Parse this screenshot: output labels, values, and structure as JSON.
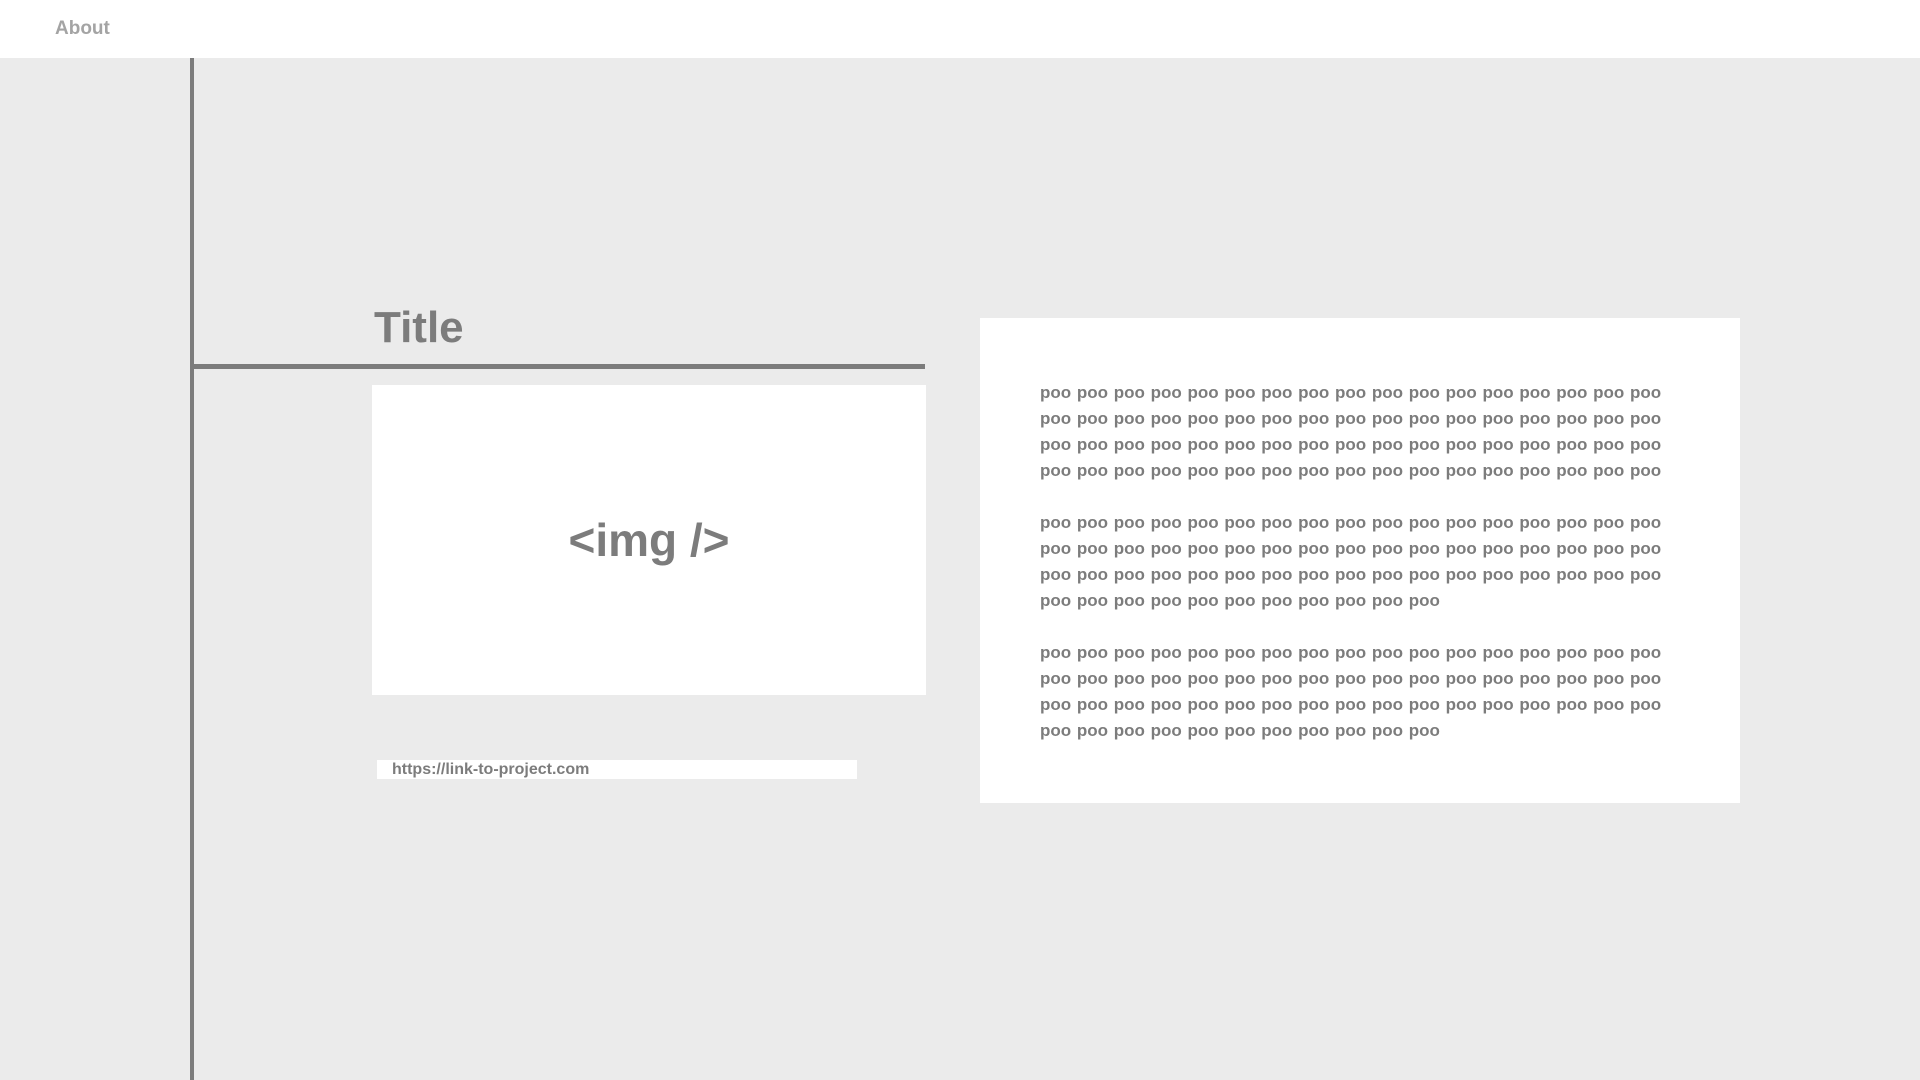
{
  "nav": {
    "about_label": "About"
  },
  "project": {
    "title": "Title",
    "image_placeholder": "<img />",
    "link": "https://link-to-project.com"
  },
  "description": {
    "paragraphs": [
      "poo poo poo poo poo poo poo poo poo poo poo poo poo poo poo poo poo poo poo poo poo poo poo poo poo poo poo poo poo poo poo poo poo poo poo poo poo poo poo poo poo poo poo poo poo poo poo poo poo poo poo poo poo poo poo poo poo poo poo poo poo poo poo poo poo poo poo poo",
      "poo poo poo poo poo poo poo poo poo poo poo poo poo poo poo poo poo poo poo poo poo poo poo poo poo poo poo poo poo poo poo poo poo poo poo poo poo poo poo poo poo poo poo poo poo poo poo poo poo poo poo poo poo poo poo poo poo poo poo poo poo poo",
      "poo poo poo poo poo poo poo poo poo poo poo poo poo poo poo poo poo poo poo poo poo poo poo poo poo poo poo poo poo poo poo poo poo poo poo poo poo poo poo poo poo poo poo poo poo poo poo poo poo poo poo poo poo poo poo poo poo poo poo poo poo poo"
    ]
  },
  "colors": {
    "background": "#ebebeb",
    "surface": "#ffffff",
    "text": "#7c7c7c",
    "nav_text": "#a4a4a4"
  }
}
